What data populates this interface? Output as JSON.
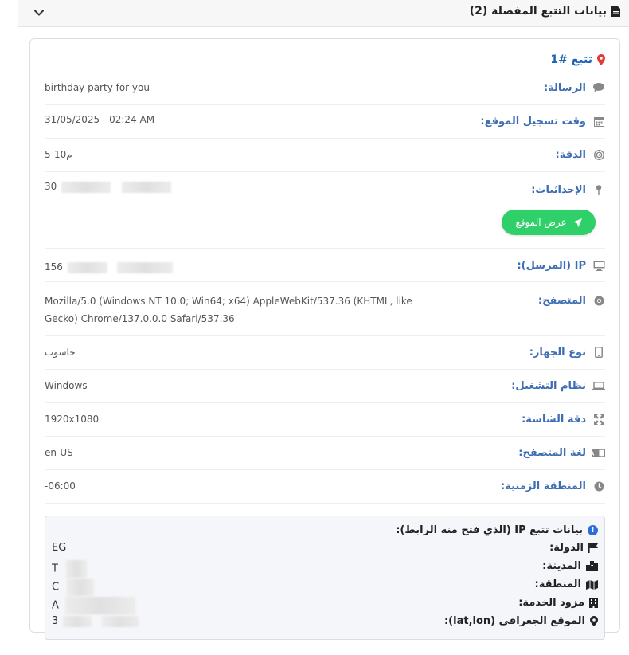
{
  "header": {
    "title": "بيانات التتبع المفصلة (2)"
  },
  "track": {
    "title": "تتبع #1"
  },
  "rows": [
    {
      "label": "الرسالة:",
      "value": "birthday party for you",
      "icon": "comment-icon"
    },
    {
      "label": "وقت تسجيل الموقع:",
      "value": "31/05/2025 - 02:24 AM",
      "icon": "calendar-icon"
    },
    {
      "label": "الدقة:",
      "value": "5-10م",
      "icon": "target-icon"
    },
    {
      "label": "الإحداثيات:",
      "value": "30",
      "icon": "pin-icon"
    },
    {
      "label": "IP (المرسل):",
      "value": "156",
      "icon": "desktop-icon"
    },
    {
      "label": "المتصفح:",
      "value_line1": "Mozilla/5.0 (Windows NT 10.0; Win64; x64) AppleWebKit/537.36 (KHTML, like",
      "value_line2": "Gecko) Chrome/137.0.0.0 Safari/537.36",
      "icon": "chrome-icon"
    },
    {
      "label": "نوع الجهاز:",
      "value": "حاسوب",
      "icon": "mobile-icon"
    },
    {
      "label": "نظام التشغيل:",
      "value": "Windows",
      "icon": "laptop-icon"
    },
    {
      "label": "دقة الشاشة:",
      "value": "1920x1080",
      "icon": "expand-icon"
    },
    {
      "label": "لغة المتصفح:",
      "value": "en-US",
      "icon": "language-icon"
    },
    {
      "label": "المنطقة الزمنية:",
      "value": "-06:00",
      "icon": "clock-icon"
    }
  ],
  "show_location_button": {
    "label": "عرض الموقع"
  },
  "ip_box": {
    "title": "بيانات تتبع IP (الذي فتح منه الرابط):",
    "items": [
      {
        "label": "الدولة:",
        "value": "EG",
        "icon": "flag-icon"
      },
      {
        "label": "المدينة:",
        "value": "T",
        "icon": "city-icon"
      },
      {
        "label": "المنطقة:",
        "value": "C",
        "icon": "map-icon"
      },
      {
        "label": "مزود الخدمة:",
        "value": "A",
        "icon": "building-icon"
      },
      {
        "label": "الموقع الجغرافي (lat,lon):",
        "value": "3",
        "icon": "map-marker-icon"
      }
    ]
  },
  "colors": {
    "accent": "#3d6db3",
    "button": "#2fcf6a",
    "marker": "#e53935"
  }
}
